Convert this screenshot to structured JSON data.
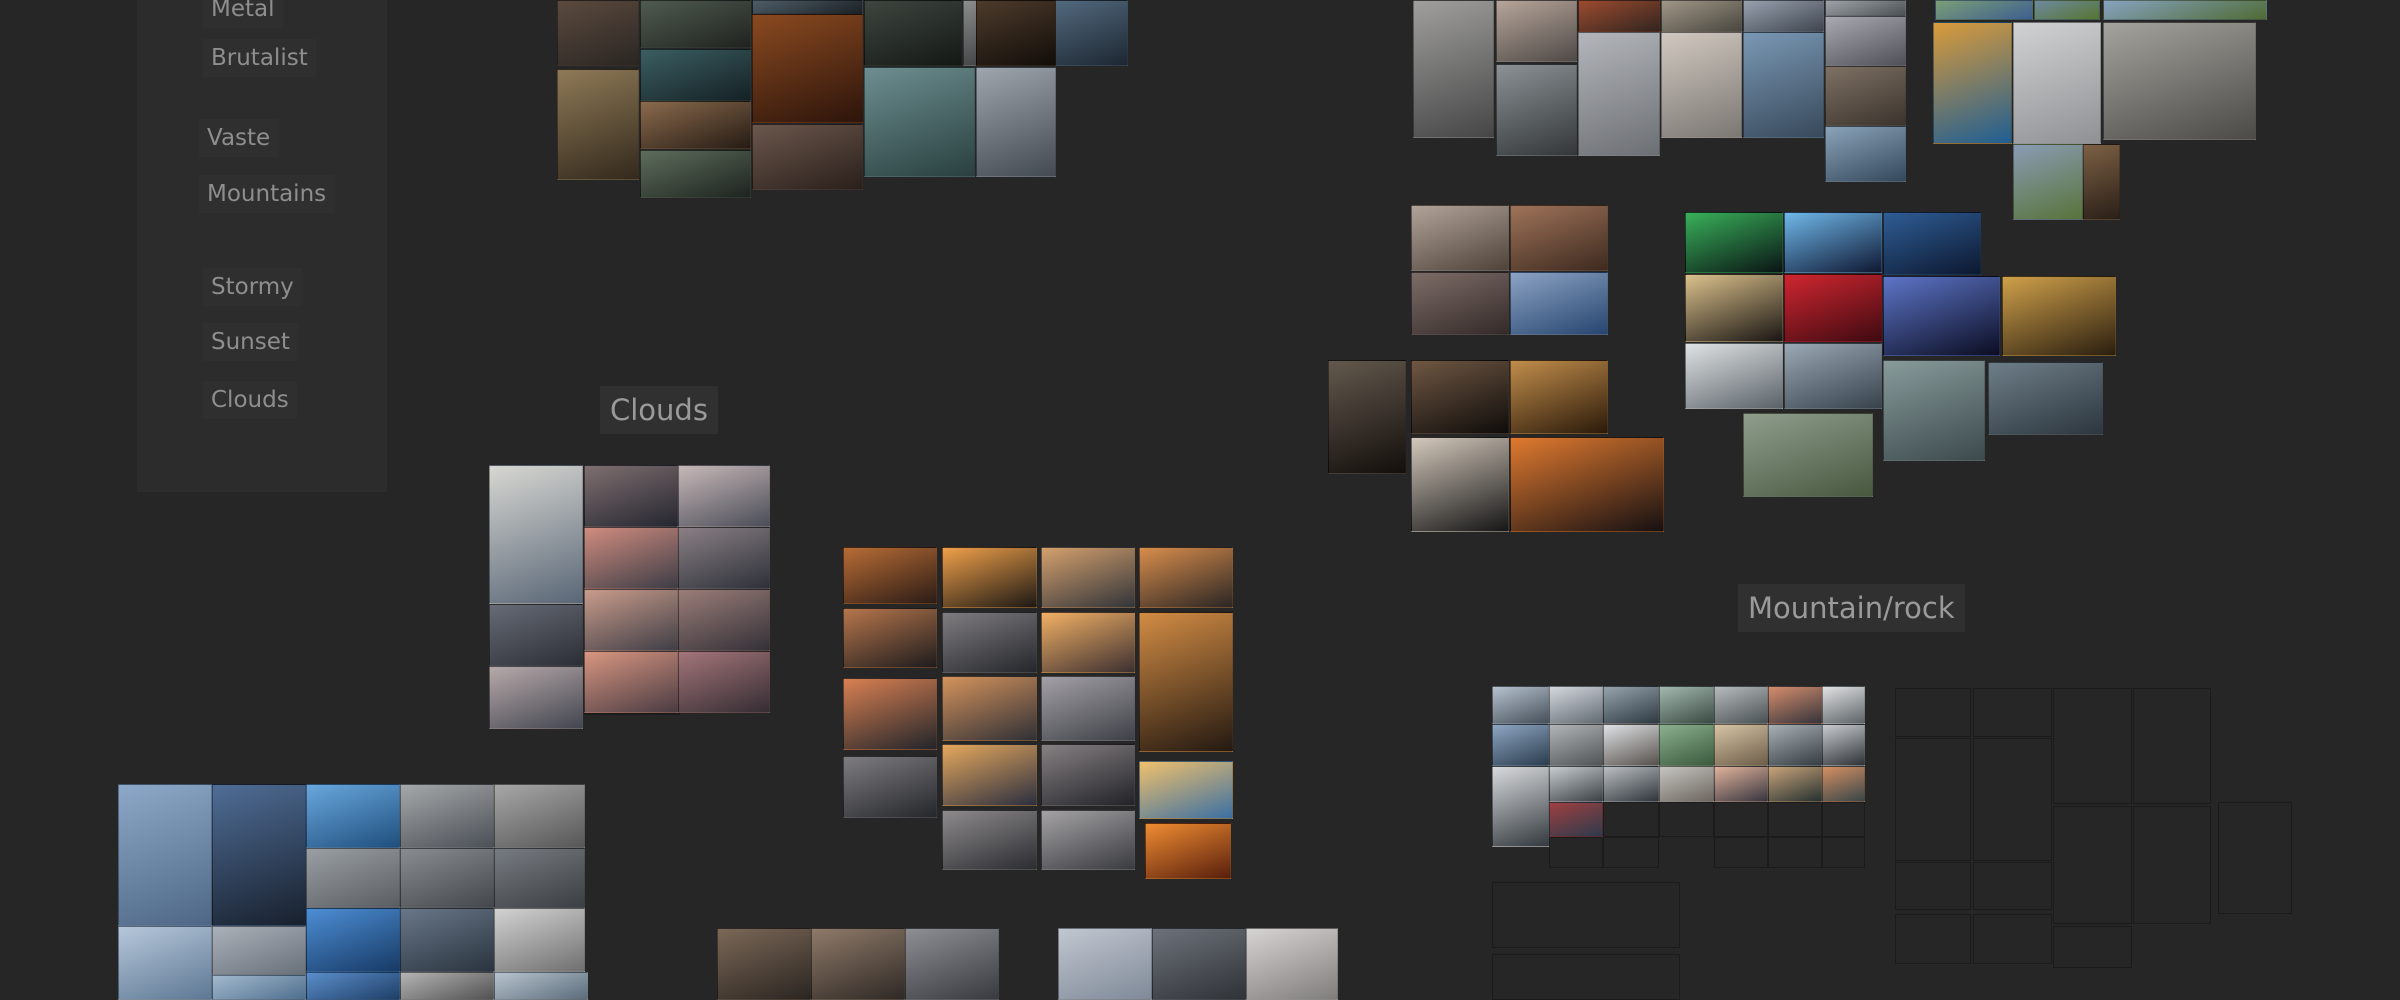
{
  "canvas": {
    "background": "#262626",
    "panel_background": "#2c2c2c",
    "chip_background": "#2f2f2f",
    "chip_text_color": "#8e8e8e"
  },
  "tag_panel": {
    "tags": [
      "Metal",
      "Brutalist",
      "Vaste",
      "Mountains",
      "Stormy",
      "Sunset",
      "Clouds"
    ]
  },
  "section_labels": {
    "clouds": "Clouds",
    "mountain_rock": "Mountain/rock"
  },
  "thumbnails": [
    {
      "group": "concept-art",
      "colors": [
        "#5b4a3f",
        "#2a2622"
      ]
    },
    {
      "group": "concept-art",
      "colors": [
        "#4f5b50",
        "#20231f"
      ]
    },
    {
      "group": "concept-art",
      "colors": [
        "#4e5c67",
        "#1b2226"
      ]
    },
    {
      "group": "concept-art",
      "colors": [
        "#8a4a20",
        "#2d140b"
      ]
    },
    {
      "group": "concept-art",
      "colors": [
        "#3e463f",
        "#141815"
      ]
    },
    {
      "group": "concept-art",
      "colors": [
        "#8c8c8c",
        "#36383b"
      ]
    },
    {
      "group": "concept-art",
      "colors": [
        "#5a7389",
        "#1d2732"
      ]
    },
    {
      "group": "concept-art",
      "colors": [
        "#8f7a57",
        "#33291c"
      ]
    },
    {
      "group": "concept-art",
      "colors": [
        "#3b5e62",
        "#152125"
      ]
    },
    {
      "group": "concept-art",
      "colors": [
        "#6d8e91",
        "#29403f"
      ]
    },
    {
      "group": "concept-art",
      "colors": [
        "#8a6a4d",
        "#261c14"
      ]
    },
    {
      "group": "concept-art",
      "colors": [
        "#5d6d5b",
        "#1e2420"
      ]
    },
    {
      "group": "concept-art",
      "colors": [
        "#6b574c",
        "#2a1f1b"
      ]
    },
    {
      "group": "concept-art",
      "colors": [
        "#9ea5ad",
        "#434b52"
      ]
    },
    {
      "group": "concept-art",
      "colors": [
        "#4d3b2b",
        "#120d09"
      ]
    },
    {
      "group": "clouds",
      "colors": [
        "#d7d7d2",
        "#5a6777"
      ]
    },
    {
      "group": "clouds",
      "colors": [
        "#7f6f70",
        "#252630"
      ]
    },
    {
      "group": "clouds",
      "colors": [
        "#c7b8b8",
        "#4b4d58"
      ]
    },
    {
      "group": "clouds",
      "colors": [
        "#d08c7f",
        "#3d3d46"
      ]
    },
    {
      "group": "clouds",
      "colors": [
        "#8a7f85",
        "#2e3139"
      ]
    },
    {
      "group": "clouds",
      "colors": [
        "#c99c8b",
        "#403e46"
      ]
    },
    {
      "group": "clouds",
      "colors": [
        "#676b76",
        "#2b2e35"
      ]
    },
    {
      "group": "clouds",
      "colors": [
        "#9b7d78",
        "#343138"
      ]
    },
    {
      "group": "clouds",
      "colors": [
        "#d89681",
        "#4b3c43"
      ]
    },
    {
      "group": "clouds",
      "colors": [
        "#a37579",
        "#352d33"
      ]
    },
    {
      "group": "clouds",
      "colors": [
        "#b7a9aa",
        "#434650"
      ]
    },
    {
      "group": "clouds",
      "colors": [
        "#d28b73",
        "#4b3532"
      ]
    },
    {
      "group": "clouds",
      "colors": [
        "#c69ba2",
        "#4b3b45"
      ]
    },
    {
      "group": "sunset",
      "colors": [
        "#b86c35",
        "#2c1c16"
      ]
    },
    {
      "group": "sunset",
      "colors": [
        "#f0a04a",
        "#1d1915"
      ]
    },
    {
      "group": "sunset",
      "colors": [
        "#d4a06d",
        "#33353a"
      ]
    },
    {
      "group": "sunset",
      "colors": [
        "#d88d4c",
        "#2b2624"
      ]
    },
    {
      "group": "sunset",
      "colors": [
        "#b6764c",
        "#1f1c1d"
      ]
    },
    {
      "group": "sunset",
      "colors": [
        "#7f7c7f",
        "#25272c"
      ]
    },
    {
      "group": "sunset",
      "colors": [
        "#f1b065",
        "#3d3031"
      ]
    },
    {
      "group": "sunset",
      "colors": [
        "#d28c44",
        "#241911"
      ]
    },
    {
      "group": "sunset",
      "colors": [
        "#d98052",
        "#22252a"
      ]
    },
    {
      "group": "sunset",
      "colors": [
        "#d4935c",
        "#303036"
      ]
    },
    {
      "group": "sunset",
      "colors": [
        "#a3a0a6",
        "#3f4148"
      ]
    },
    {
      "group": "sunset",
      "colors": [
        "#7e7c81",
        "#25272b"
      ]
    },
    {
      "group": "sunset",
      "colors": [
        "#e5a85d",
        "#2c2f40"
      ]
    },
    {
      "group": "sunset",
      "colors": [
        "#868082",
        "#222328"
      ]
    },
    {
      "group": "sunset",
      "colors": [
        "#f0c16c",
        "#3b6fa3"
      ]
    },
    {
      "group": "sunset",
      "colors": [
        "#8d8a8c",
        "#2c2d31"
      ]
    },
    {
      "group": "sunset",
      "colors": [
        "#a4a2a4",
        "#3a3b40"
      ]
    },
    {
      "group": "sunset",
      "colors": [
        "#ef8c32",
        "#591f0c"
      ]
    },
    {
      "group": "blue-sky",
      "colors": [
        "#8da8c8",
        "#4e6786"
      ]
    },
    {
      "group": "blue-sky",
      "colors": [
        "#4f6d96",
        "#18202d"
      ]
    },
    {
      "group": "blue-sky",
      "colors": [
        "#69a7dd",
        "#1f4f7e"
      ]
    },
    {
      "group": "blue-sky",
      "colors": [
        "#a5a8aa",
        "#4b5057"
      ]
    },
    {
      "group": "blue-sky",
      "colors": [
        "#a7a7a7",
        "#575757"
      ]
    },
    {
      "group": "blue-sky",
      "colors": [
        "#9a9fa4",
        "#5a5e63"
      ]
    },
    {
      "group": "blue-sky",
      "colors": [
        "#898d92",
        "#44474b"
      ]
    },
    {
      "group": "blue-sky",
      "colors": [
        "#777c82",
        "#3b3e42"
      ]
    },
    {
      "group": "blue-sky",
      "colors": [
        "#b6c7da",
        "#5e7894"
      ]
    },
    {
      "group": "blue-sky",
      "colors": [
        "#aab1b9",
        "#68707a"
      ]
    },
    {
      "group": "blue-sky",
      "colors": [
        "#4d8ed4",
        "#173a66"
      ]
    },
    {
      "group": "blue-sky",
      "colors": [
        "#687788",
        "#2b3440"
      ]
    },
    {
      "group": "blue-sky",
      "colors": [
        "#d2d2d2",
        "#707070"
      ]
    },
    {
      "group": "blue-sky",
      "colors": [
        "#a2b9cd",
        "#4f6f8e"
      ]
    },
    {
      "group": "blue-sky",
      "colors": [
        "#5b8eca",
        "#1f3f68"
      ]
    },
    {
      "group": "blue-sky",
      "colors": [
        "#b4b4b4",
        "#525252"
      ]
    },
    {
      "group": "blue-sky",
      "colors": [
        "#b7c4cf",
        "#5c6c7b"
      ]
    },
    {
      "group": "clouds-bottom",
      "colors": [
        "#7b6857",
        "#2b2521"
      ]
    },
    {
      "group": "clouds-bottom",
      "colors": [
        "#8f7a69",
        "#2f2925"
      ]
    },
    {
      "group": "clouds-bottom",
      "colors": [
        "#8e8f95",
        "#383a40"
      ]
    },
    {
      "group": "clouds-bottom",
      "colors": [
        "#c1c7d0",
        "#7f8998"
      ]
    },
    {
      "group": "clouds-bottom",
      "colors": [
        "#6d727a",
        "#2f3237"
      ]
    },
    {
      "group": "clouds-bottom",
      "colors": [
        "#d6d4d2",
        "#807d7d"
      ]
    },
    {
      "group": "industrial",
      "colors": [
        "#a09f9e",
        "#464646"
      ]
    },
    {
      "group": "industrial",
      "colors": [
        "#b6a59a",
        "#4f4a47"
      ]
    },
    {
      "group": "industrial",
      "colors": [
        "#9c4b2f",
        "#32251f"
      ]
    },
    {
      "group": "industrial",
      "colors": [
        "#a09687",
        "#4a4740"
      ]
    },
    {
      "group": "industrial",
      "colors": [
        "#97a1ad",
        "#3f4650"
      ]
    },
    {
      "group": "industrial",
      "colors": [
        "#9ea3a8",
        "#4c5155"
      ]
    },
    {
      "group": "industrial",
      "colors": [
        "#a8aab2",
        "#4f5058"
      ]
    },
    {
      "group": "industrial",
      "colors": [
        "#8b9195",
        "#333739"
      ]
    },
    {
      "group": "industrial",
      "colors": [
        "#b3b6ba",
        "#6c6f73"
      ]
    },
    {
      "group": "industrial",
      "colors": [
        "#d1c9c0",
        "#7b7773"
      ]
    },
    {
      "group": "industrial",
      "colors": [
        "#7a98b4",
        "#38495b"
      ]
    },
    {
      "group": "industrial",
      "colors": [
        "#7e7164",
        "#3b332d"
      ]
    },
    {
      "group": "industrial",
      "colors": [
        "#8aa3b8",
        "#34485d"
      ]
    },
    {
      "group": "industrial",
      "colors": [
        "#d99b3b",
        "#1f5e93"
      ]
    },
    {
      "group": "industrial",
      "colors": [
        "#d1d2d3",
        "#8f9194"
      ]
    },
    {
      "group": "industrial",
      "colors": [
        "#a4a39d",
        "#4c4a47"
      ]
    },
    {
      "group": "spaceport",
      "colors": [
        "#7b9e78",
        "#3d5f8f"
      ]
    },
    {
      "group": "spaceport",
      "colors": [
        "#6f8aa1",
        "#55752f"
      ]
    },
    {
      "group": "spaceport",
      "colors": [
        "#87a3c0",
        "#4f6b35"
      ]
    },
    {
      "group": "spaceport",
      "colors": [
        "#8a9cb4",
        "#58733a"
      ]
    },
    {
      "group": "spaceport",
      "colors": [
        "#7c6044",
        "#2a1f17"
      ]
    },
    {
      "group": "spaceport",
      "colors": [
        "#b1a398",
        "#4f433a"
      ]
    },
    {
      "group": "spaceport",
      "colors": [
        "#9f7359",
        "#3d2a1f"
      ]
    },
    {
      "group": "spaceport",
      "colors": [
        "#7d6d67",
        "#342a29"
      ]
    },
    {
      "group": "spaceport",
      "colors": [
        "#8ca3c4",
        "#26456f"
      ]
    },
    {
      "group": "night",
      "colors": [
        "#62584d",
        "#140f0c"
      ]
    },
    {
      "group": "night",
      "colors": [
        "#6f5743",
        "#0f0c0a"
      ]
    },
    {
      "group": "night",
      "colors": [
        "#c18d4b",
        "#2b1a0a"
      ]
    },
    {
      "group": "night",
      "colors": [
        "#d3c8bb",
        "#161616"
      ]
    },
    {
      "group": "night",
      "colors": [
        "#e07a2f",
        "#161012"
      ]
    },
    {
      "group": "night",
      "colors": [
        "#39b05a",
        "#0a1515"
      ]
    },
    {
      "group": "night",
      "colors": [
        "#6fb7e9",
        "#0f1833"
      ]
    },
    {
      "group": "night",
      "colors": [
        "#2f5d95",
        "#0c1830"
      ]
    },
    {
      "group": "night",
      "colors": [
        "#dbc18c",
        "#1a1613"
      ]
    },
    {
      "group": "night",
      "colors": [
        "#cf2630",
        "#3f0a11"
      ]
    },
    {
      "group": "night",
      "colors": [
        "#5d75c8",
        "#0b0d22"
      ]
    },
    {
      "group": "night",
      "colors": [
        "#cfa04a",
        "#2b1f10"
      ]
    },
    {
      "group": "mountain-left",
      "colors": [
        "#dfe2e4",
        "#5b6369"
      ]
    },
    {
      "group": "mountain-left",
      "colors": [
        "#9aa8b5",
        "#37424c"
      ]
    },
    {
      "group": "mountain-left",
      "colors": [
        "#889b9b",
        "#3c4a4d"
      ]
    },
    {
      "group": "mountain-left",
      "colors": [
        "#6e7e88",
        "#2c363e"
      ]
    },
    {
      "group": "mountain-left",
      "colors": [
        "#8f9e8d",
        "#48583f"
      ]
    },
    {
      "group": "mountain-left",
      "colors": [
        "#b6c2cf",
        "#46505a"
      ]
    },
    {
      "group": "mountain-left",
      "colors": [
        "#d4d8dd",
        "#626b73"
      ]
    },
    {
      "group": "mountain-left",
      "colors": [
        "#96a3ac",
        "#2e3942"
      ]
    },
    {
      "group": "mountain-left",
      "colors": [
        "#a3b8b0",
        "#3a4a43"
      ]
    },
    {
      "group": "mountain-left",
      "colors": [
        "#b7bbbd",
        "#4a5154"
      ]
    },
    {
      "group": "mountain-left",
      "colors": [
        "#d58d6d",
        "#36353b"
      ]
    },
    {
      "group": "mountain-left",
      "colors": [
        "#e0e1e2",
        "#5d6469"
      ]
    },
    {
      "group": "mountain-left",
      "colors": [
        "#8ea6c2",
        "#2b3d4f"
      ]
    },
    {
      "group": "mountain-left",
      "colors": [
        "#b2b5b6",
        "#4f5457"
      ]
    },
    {
      "group": "mountain-right",
      "colors": [
        "#dfe2e5",
        "#57514c"
      ]
    },
    {
      "group": "mountain-right",
      "colors": [
        "#8cb08e",
        "#3a5b3e"
      ]
    },
    {
      "group": "mountain-right",
      "colors": [
        "#d6c4a4",
        "#6d5d49"
      ]
    },
    {
      "group": "mountain-right",
      "colors": [
        "#a8b1b6",
        "#363d43"
      ]
    },
    {
      "group": "mountain-right",
      "colors": [
        "#c8cbcf",
        "#2f3337"
      ]
    },
    {
      "group": "mountain-right",
      "colors": [
        "#d8dadd",
        "#343a3f"
      ]
    },
    {
      "group": "mountain-right",
      "colors": [
        "#c7ccd0",
        "#3c4146"
      ]
    },
    {
      "group": "mountain-right",
      "colors": [
        "#bbbfc3",
        "#30363c"
      ]
    },
    {
      "group": "mountain-right",
      "colors": [
        "#c5c5c1",
        "#6e665f"
      ]
    },
    {
      "group": "mountain-right",
      "colors": [
        "#e1b39b",
        "#383640"
      ]
    },
    {
      "group": "mountain-right",
      "colors": [
        "#c8a37b",
        "#263230"
      ]
    },
    {
      "group": "mountain-right",
      "colors": [
        "#d48f62",
        "#394649"
      ]
    },
    {
      "group": "mountain-right",
      "colors": [
        "#9e4040",
        "#2d3a4c"
      ]
    }
  ]
}
